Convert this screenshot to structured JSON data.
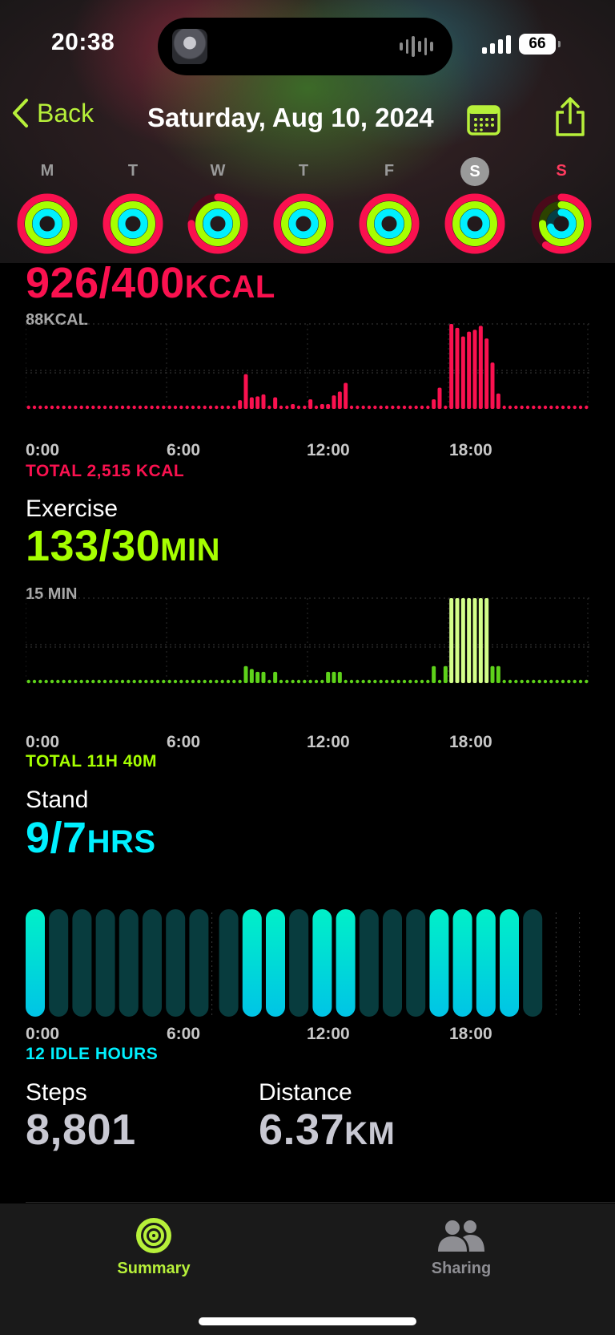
{
  "status": {
    "time": "20:38",
    "battery": "66"
  },
  "nav": {
    "back_label": "Back",
    "title": "Saturday, Aug 10, 2024"
  },
  "colors": {
    "move": "#fa114f",
    "exercise": "#a6ff00",
    "stand": "#00f0ff",
    "accent": "#b7f03a"
  },
  "week": [
    {
      "letter": "M",
      "move": 1.4,
      "exercise": 1.6,
      "stand": 1.2
    },
    {
      "letter": "T",
      "move": 1.4,
      "exercise": 1.7,
      "stand": 1.3
    },
    {
      "letter": "W",
      "move": 0.75,
      "exercise": 1.5,
      "stand": 1.1
    },
    {
      "letter": "T",
      "move": 1.4,
      "exercise": 1.6,
      "stand": 1.2
    },
    {
      "letter": "F",
      "move": 1.4,
      "exercise": 1.5,
      "stand": 1.3
    },
    {
      "letter": "S",
      "move": 2.3,
      "exercise": 4.4,
      "stand": 1.3,
      "selected": true
    },
    {
      "letter": "S",
      "move": 0.6,
      "exercise": 0.75,
      "stand": 0.7,
      "today": true
    }
  ],
  "move": {
    "value": "926/400",
    "unit": "KCAL",
    "max_label": "88KCAL",
    "total": "TOTAL 2,515 KCAL",
    "axis": [
      "0:00",
      "6:00",
      "12:00",
      "18:00"
    ],
    "chart_data": {
      "type": "bar",
      "x": [
        0,
        1,
        2,
        3,
        4,
        5,
        6,
        7,
        8,
        9,
        10,
        11,
        12,
        13,
        14,
        15,
        16,
        17,
        18,
        19,
        20,
        21,
        22,
        23,
        24,
        25,
        26,
        27,
        28,
        29,
        30,
        31,
        32,
        33,
        34,
        35,
        36,
        37,
        38,
        39,
        40,
        41,
        42,
        43,
        44,
        45,
        46,
        47,
        48,
        49,
        50,
        51,
        52,
        53,
        54,
        55,
        56,
        57,
        58,
        59,
        60,
        61,
        62,
        63,
        64,
        65,
        66,
        67,
        68,
        69,
        70,
        71,
        72,
        73,
        74,
        75,
        76,
        77,
        78,
        79,
        80,
        81,
        82,
        83,
        84,
        85,
        86,
        87,
        88,
        89,
        90,
        91,
        92,
        93,
        94,
        95
      ],
      "values": [
        0,
        0,
        0,
        0,
        0,
        0,
        0,
        0,
        0,
        0,
        0,
        0,
        0,
        0,
        0,
        0,
        0,
        0,
        0,
        0,
        0,
        0,
        0,
        0,
        0,
        0,
        0,
        0,
        0,
        0,
        0,
        0,
        0,
        0,
        0,
        0,
        9,
        36,
        12,
        13,
        15,
        2,
        12,
        2,
        2,
        3,
        2,
        2,
        10,
        2,
        3,
        5,
        14,
        18,
        27,
        2,
        2,
        2,
        2,
        2,
        2,
        2,
        2,
        2,
        2,
        2,
        2,
        2,
        2,
        10,
        22,
        2,
        88,
        84,
        75,
        80,
        82,
        86,
        73,
        48,
        16,
        2,
        2,
        2,
        2,
        2,
        2,
        2,
        2,
        2,
        2,
        2,
        2,
        2,
        2,
        2
      ],
      "ylim": [
        0,
        88
      ],
      "xlabel": "",
      "ylabel": ""
    }
  },
  "exercise": {
    "label": "Exercise",
    "value": "133/30",
    "unit": "MIN",
    "max_label": "15 MIN",
    "total": "TOTAL 11H 40M",
    "axis": [
      "0:00",
      "6:00",
      "12:00",
      "18:00"
    ],
    "chart_data": {
      "type": "bar",
      "x": [
        0,
        1,
        2,
        3,
        4,
        5,
        6,
        7,
        8,
        9,
        10,
        11,
        12,
        13,
        14,
        15,
        16,
        17,
        18,
        19,
        20,
        21,
        22,
        23,
        24,
        25,
        26,
        27,
        28,
        29,
        30,
        31,
        32,
        33,
        34,
        35,
        36,
        37,
        38,
        39,
        40,
        41,
        42,
        43,
        44,
        45,
        46,
        47,
        48,
        49,
        50,
        51,
        52,
        53,
        54,
        55,
        56,
        57,
        58,
        59,
        60,
        61,
        62,
        63,
        64,
        65,
        66,
        67,
        68,
        69,
        70,
        71,
        72,
        73,
        74,
        75,
        76,
        77,
        78,
        79,
        80,
        81,
        82,
        83,
        84,
        85,
        86,
        87,
        88,
        89,
        90,
        91,
        92,
        93,
        94,
        95
      ],
      "values": [
        0,
        0,
        0,
        0,
        0,
        0,
        0,
        0,
        0,
        0,
        0,
        0,
        0,
        0,
        0,
        0,
        0,
        0,
        0,
        0,
        0,
        0,
        0,
        0,
        0,
        0,
        0,
        0,
        0,
        0,
        0,
        0,
        0,
        0,
        0,
        0,
        0,
        3,
        2.5,
        2,
        2,
        0,
        2,
        0,
        0,
        0,
        0,
        0,
        0,
        0,
        0,
        2,
        2,
        2,
        0,
        0,
        0,
        0,
        0,
        0,
        0,
        0,
        0,
        0,
        0,
        0,
        0,
        0,
        0,
        3,
        0,
        3,
        15,
        15,
        15,
        15,
        15,
        15,
        15,
        3,
        3,
        0,
        0,
        0,
        0,
        0,
        0,
        0,
        0,
        0,
        0,
        0,
        0,
        0,
        0,
        0
      ],
      "ylim": [
        0,
        15
      ],
      "xlabel": "",
      "ylabel": ""
    }
  },
  "stand": {
    "label": "Stand",
    "value": "9/7",
    "unit": "HRS",
    "idle": "12 IDLE HOURS",
    "axis": [
      "0:00",
      "6:00",
      "12:00",
      "18:00"
    ],
    "chart_data": {
      "type": "bar",
      "x": [
        0,
        1,
        2,
        3,
        4,
        5,
        6,
        7,
        8,
        9,
        10,
        11,
        12,
        13,
        14,
        15,
        16,
        17,
        18,
        19,
        20,
        21,
        22,
        23
      ],
      "values": [
        1,
        0,
        0,
        0,
        0,
        0,
        0,
        0,
        0,
        1,
        1,
        0,
        1,
        1,
        0,
        0,
        0,
        1,
        1,
        1,
        1,
        0,
        0,
        0
      ],
      "series_name": "stood"
    }
  },
  "steps": {
    "label": "Steps",
    "value": "8,801"
  },
  "distance": {
    "label": "Distance",
    "value": "6.37",
    "unit": "KM"
  },
  "tabs": [
    {
      "label": "Summary",
      "active": true
    },
    {
      "label": "Sharing",
      "active": false
    }
  ]
}
